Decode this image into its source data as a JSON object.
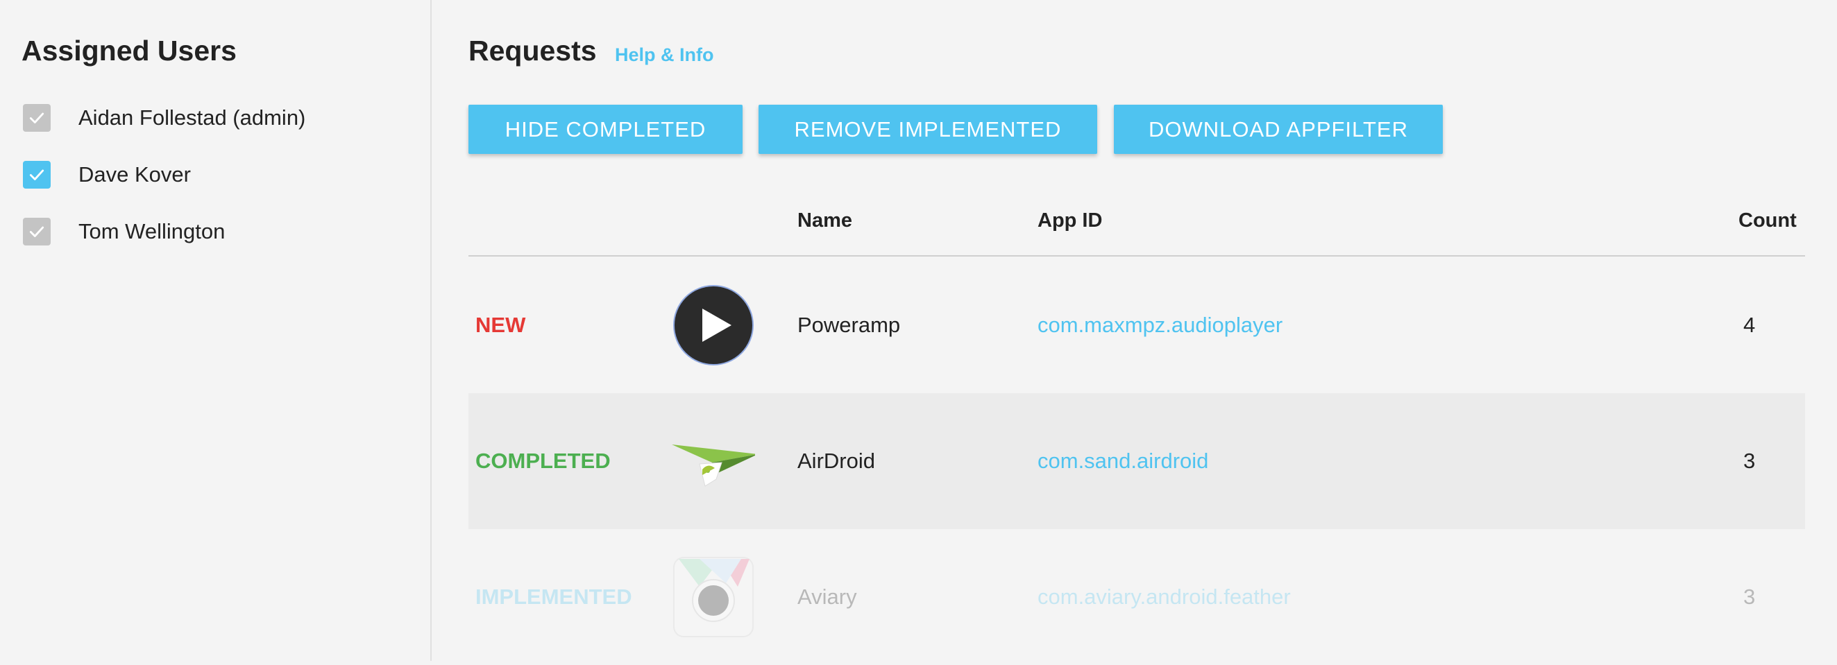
{
  "sidebar": {
    "title": "Assigned Users",
    "users": [
      {
        "name": "Aidan Follestad (admin)",
        "checked": true,
        "style": "grey"
      },
      {
        "name": "Dave Kover",
        "checked": true,
        "style": "blue"
      },
      {
        "name": "Tom Wellington",
        "checked": true,
        "style": "grey"
      }
    ]
  },
  "main": {
    "title": "Requests",
    "help_link": "Help & Info",
    "buttons": {
      "hide_completed": "HIDE COMPLETED",
      "remove_implemented": "REMOVE IMPLEMENTED",
      "download_appfilter": "DOWNLOAD APPFILTER"
    },
    "table": {
      "headers": {
        "name": "Name",
        "app_id": "App ID",
        "count": "Count"
      },
      "rows": [
        {
          "status": "NEW",
          "status_color": "#e53935",
          "icon": "play-icon",
          "name": "Poweramp",
          "app_id": "com.maxmpz.audioplayer",
          "count": "4"
        },
        {
          "status": "COMPLETED",
          "status_color": "#4caf50",
          "icon": "paper-plane-icon",
          "name": "AirDroid",
          "app_id": "com.sand.airdroid",
          "count": "3"
        },
        {
          "status": "IMPLEMENTED",
          "status_color": "#4fc3f0",
          "icon": "camera-lens-icon",
          "name": "Aviary",
          "app_id": "com.aviary.android.feather",
          "count": "3"
        }
      ]
    }
  },
  "colors": {
    "accent": "#4fc3f0",
    "new": "#e53935",
    "completed": "#4caf50"
  }
}
